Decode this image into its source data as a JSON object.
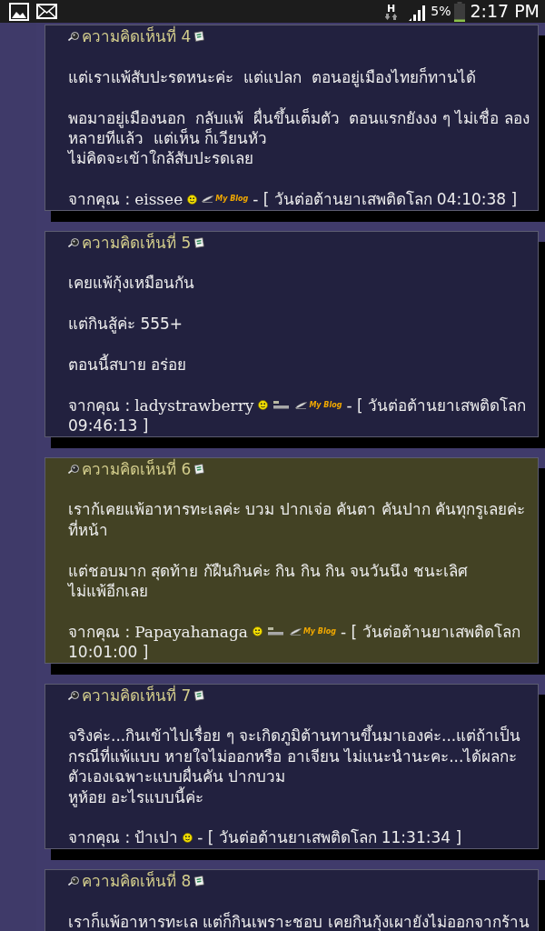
{
  "status_bar": {
    "network": "H",
    "battery": "5%",
    "time": "2:17 PM"
  },
  "comments": [
    {
      "title": "ความคิดเห็นที่ 4",
      "highlighted": false,
      "body": [
        [
          "แต่เราแพ้สับปะรดหนะค่ะ  แต่แปลก  ตอนอยู่เมืองไทยก็ทานได้"
        ],
        [
          "พอมาอยู่เมืองนอก  กลับแพ้  ผื่นขึ้นเต็มตัว  ตอนแรกยังงง ๆ ไม่เชื่อ ลองหลายทีแล้ว  แต่เห็น ก็เวียนหัว",
          "ไม่คิดจะเข้าใกล้สับปะรดเลย"
        ]
      ],
      "from_label": "จากคุณ :",
      "author": "eissee",
      "badges": [
        {
          "kind": "smiley"
        },
        {
          "kind": "blog",
          "label": "My Blog"
        }
      ],
      "date": "- [ วันต่อต้านยาเสพติดโลก",
      "time": "04:10:38 ]"
    },
    {
      "title": "ความคิดเห็นที่ 5",
      "highlighted": false,
      "body": [
        [
          "เคยแพ้กุ้งเหมือนกัน"
        ],
        [
          "แต่กินสู้ค่ะ 555+"
        ],
        [
          "ตอนนี้สบาย อร่อย"
        ]
      ],
      "from_label": "จากคุณ :",
      "author": "ladystrawberry",
      "badges": [
        {
          "kind": "smiley"
        },
        {
          "kind": "fbox"
        },
        {
          "kind": "blog",
          "label": "My Blog"
        }
      ],
      "date": "- [ วันต่อต้านยาเสพติดโลก",
      "time": "09:46:13 ]"
    },
    {
      "title": "ความคิดเห็นที่ 6",
      "highlighted": true,
      "body": [
        [
          "เราก้เคยแพ้อาหารทะเลค่ะ บวม ปากเจ่อ คันตา คันปาก คันทุกรูเลยค่ะที่หน้า"
        ],
        [
          "แต่ชอบมาก สุดท้าย ก้ฝืนกินค่ะ กิน กิน กิน จนวันนึง ชนะเลิศ",
          "ไม่แพ้อีกเลย"
        ]
      ],
      "from_label": "จากคุณ :",
      "author": "Papayahanaga",
      "badges": [
        {
          "kind": "smiley"
        },
        {
          "kind": "fbox"
        },
        {
          "kind": "blog",
          "label": "My Blog"
        }
      ],
      "date": "- [ วันต่อต้านยาเสพติดโลก",
      "time": "10:01:00 ]"
    },
    {
      "title": "ความคิดเห็นที่ 7",
      "highlighted": false,
      "body": [
        [
          "จริงค่ะ...กินเข้าไปเรื่อย ๆ จะเกิดภูมิต้านทานขึ้นมาเองค่ะ...แต่ถ้าเป็นกรณีที่แพ้แบบ หายใจไม่ออกหรือ อาเจียน ไม่แนะนำนะคะ...ได้ผลกะตัวเองเฉพาะแบบผื่นคัน ปากบวม",
          "หูห้อย อะไรแบบนี้ค่ะ"
        ]
      ],
      "from_label": "จากคุณ :",
      "author": "ป้าเปา",
      "badges": [
        {
          "kind": "smiley"
        }
      ],
      "date": "- [ วันต่อต้านยาเสพติดโลก",
      "time": "11:31:34 ]"
    },
    {
      "title": "ความคิดเห็นที่ 8",
      "highlighted": false,
      "body": [
        [
          "เราก็แพ้อาหารทะเล แต่ก็กินเพราะชอบ เคยกินกุ้งเผายังไม่ออกจากร้าน"
        ]
      ]
    }
  ]
}
